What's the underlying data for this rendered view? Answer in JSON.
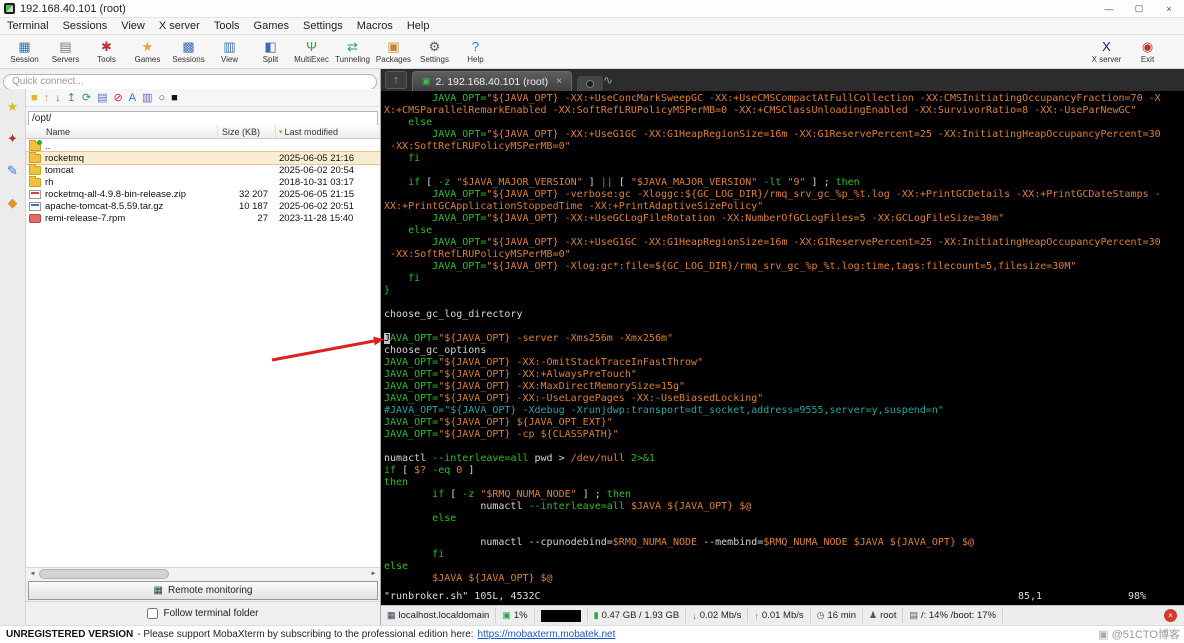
{
  "window": {
    "title": "192.168.40.101 (root)",
    "controls": {
      "minimize": "—",
      "maximize": "▢",
      "close": "×"
    }
  },
  "menu": {
    "items": [
      "Terminal",
      "Sessions",
      "View",
      "X server",
      "Tools",
      "Games",
      "Settings",
      "Macros",
      "Help"
    ]
  },
  "toolbar": {
    "left": [
      {
        "label": "Session",
        "glyph": "▦",
        "color": "#3b6fae"
      },
      {
        "label": "Servers",
        "glyph": "▤",
        "color": "#6f7d8c"
      },
      {
        "label": "Tools",
        "glyph": "✱",
        "color": "#c03030"
      },
      {
        "label": "Games",
        "glyph": "★",
        "color": "#e2a63d"
      },
      {
        "label": "Sessions",
        "glyph": "▩",
        "color": "#3b6fae"
      },
      {
        "label": "View",
        "glyph": "▥",
        "color": "#3b6fae"
      },
      {
        "label": "Split",
        "glyph": "◧",
        "color": "#3b6fae"
      },
      {
        "label": "MultiExec",
        "glyph": "Ψ",
        "color": "#2e9e50"
      },
      {
        "label": "Tunneling",
        "glyph": "⇄",
        "color": "#2e9e50"
      },
      {
        "label": "Packages",
        "glyph": "▣",
        "color": "#c8872f"
      },
      {
        "label": "Settings",
        "glyph": "⚙",
        "color": "#5a5a5a"
      },
      {
        "label": "Help",
        "glyph": "?",
        "color": "#2a7ade"
      }
    ],
    "right": [
      {
        "label": "X server",
        "glyph": "X",
        "color": "#15157d"
      },
      {
        "label": "Exit",
        "glyph": "◉",
        "color": "#c03030"
      }
    ]
  },
  "quick_connect": {
    "placeholder": "Quick connect..."
  },
  "side_tabs": [
    {
      "name": "sessions",
      "glyph": "★",
      "color": "#e2b52e"
    },
    {
      "name": "tools",
      "glyph": "✦",
      "color": "#b23030"
    },
    {
      "name": "macros",
      "glyph": "✎",
      "color": "#2a7ade"
    },
    {
      "name": "sftp",
      "glyph": "◆",
      "color": "#e2932e"
    }
  ],
  "file_browser": {
    "toolbar_icons": [
      {
        "name": "home-folder-icon",
        "glyph": "■",
        "color": "#e2b52e"
      },
      {
        "name": "up-folder-icon",
        "glyph": "↑",
        "color": "#caa22e"
      },
      {
        "name": "download-icon",
        "glyph": "↓",
        "color": "#4a7ab5"
      },
      {
        "name": "upload-icon",
        "glyph": "↥",
        "color": "#2e9e50"
      },
      {
        "name": "refresh-icon",
        "glyph": "⟳",
        "color": "#2e9e50"
      },
      {
        "name": "new-file-icon",
        "glyph": "▤",
        "color": "#4a7ab5"
      },
      {
        "name": "stop-icon",
        "glyph": "⊘",
        "color": "#c03030"
      },
      {
        "name": "encoding-icon",
        "glyph": "A",
        "color": "#2a7ade"
      },
      {
        "name": "chart-icon",
        "glyph": "▥",
        "color": "#7a4fc0"
      },
      {
        "name": "find-icon",
        "glyph": "○",
        "color": "#555555"
      },
      {
        "name": "terminal-icon",
        "glyph": "■",
        "color": "#111111"
      }
    ],
    "path": "/opt/",
    "columns": [
      "Name",
      "Size (KB)",
      "Last modified"
    ],
    "sort_indicator": "▾",
    "rows": [
      {
        "name": "..",
        "type": "folder-up",
        "size": "",
        "modified": "",
        "selected": false
      },
      {
        "name": "rocketmq",
        "type": "folder",
        "size": "",
        "modified": "2025-06-05 21:16",
        "selected": true
      },
      {
        "name": "tomcat",
        "type": "folder",
        "size": "",
        "modified": "2025-06-02 20:54",
        "selected": false
      },
      {
        "name": "rh",
        "type": "folder",
        "size": "",
        "modified": "2018-10-31 03:17",
        "selected": false
      },
      {
        "name": "rocketmq-all-4.9.8-bin-release.zip",
        "type": "zip",
        "size": "32 207",
        "modified": "2025-06-05 21:15",
        "selected": false
      },
      {
        "name": "apache-tomcat-8.5.59.tar.gz",
        "type": "targz",
        "size": "10 187",
        "modified": "2025-06-02 20:51",
        "selected": false
      },
      {
        "name": "remi-release-7.rpm",
        "type": "rpm",
        "size": "27",
        "modified": "2023-11-28 15:40",
        "selected": false
      }
    ],
    "scroll": {
      "left": "◄",
      "right": "►"
    },
    "remote_monitoring": {
      "icon": "▦",
      "label": "Remote monitoring"
    },
    "follow_terminal_label": "Follow terminal folder"
  },
  "terminal": {
    "nav_up_glyph": "↑",
    "tab": {
      "icon": "▣",
      "label": "2. 192.168.40.101 (root)",
      "close": "×"
    },
    "attach_glyph": "∿",
    "status": {
      "left": "\"runbroker.sh\" 105L, 4532C",
      "position": "85,1",
      "percent": "98%"
    },
    "lines": [
      [
        [
          "tw",
          "        "
        ],
        [
          "tg",
          "JAVA_OPT="
        ],
        [
          "to",
          "\"${JAVA_OPT} -XX:+UseConcMarkSweepGC -XX:+UseCMSCompactAtFullCollection -XX:CMSInitiatingOccupancyFraction=70 -X"
        ]
      ],
      [
        [
          "to",
          "X:+CMSParallelRemarkEnabled -XX:SoftRefLRUPolicyMSPerMB=0 -XX:+CMSClassUnloadingEnabled -XX:SurvivorRatio=8 -XX:-UseParNewGC\""
        ]
      ],
      [
        [
          "tw",
          "    "
        ],
        [
          "tg",
          "else"
        ]
      ],
      [
        [
          "tw",
          "        "
        ],
        [
          "tg",
          "JAVA_OPT="
        ],
        [
          "to",
          "\"${JAVA_OPT} -XX:+UseG1GC -XX:G1HeapRegionSize=16m -XX:G1ReservePercent=25 -XX:InitiatingHeapOccupancyPercent=30"
        ]
      ],
      [
        [
          "to",
          " -XX:SoftRefLRUPolicyMSPerMB=0\""
        ]
      ],
      [
        [
          "tw",
          "    "
        ],
        [
          "tg",
          "fi"
        ]
      ],
      [],
      [
        [
          "tw",
          "    "
        ],
        [
          "tg",
          "if"
        ],
        [
          "tw",
          " [ "
        ],
        [
          "tg",
          "-z"
        ],
        [
          "tw",
          " "
        ],
        [
          "to",
          "\"$JAVA_MAJOR_VERSION\""
        ],
        [
          "tw",
          " ] "
        ],
        [
          "tg",
          "||"
        ],
        [
          "tw",
          " [ "
        ],
        [
          "to",
          "\"$JAVA_MAJOR_VERSION\""
        ],
        [
          "tw",
          " "
        ],
        [
          "tg",
          "-lt"
        ],
        [
          "tw",
          " "
        ],
        [
          "to",
          "\"9\""
        ],
        [
          "tw",
          " ] ; "
        ],
        [
          "tg",
          "then"
        ]
      ],
      [
        [
          "tw",
          "        "
        ],
        [
          "tg",
          "JAVA_OPT="
        ],
        [
          "to",
          "\"${JAVA_OPT} -verbose:gc -Xloggc:${GC_LOG_DIR}/rmq_srv_gc_%p_%t.log -XX:+PrintGCDetails -XX:+PrintGCDateStamps -"
        ]
      ],
      [
        [
          "to",
          "XX:+PrintGCApplicationStoppedTime -XX:+PrintAdaptiveSizePolicy\""
        ]
      ],
      [
        [
          "tw",
          "        "
        ],
        [
          "tg",
          "JAVA_OPT="
        ],
        [
          "to",
          "\"${JAVA_OPT} -XX:+UseGCLogFileRotation -XX:NumberOfGCLogFiles=5 -XX:GCLogFileSize=30m\""
        ]
      ],
      [
        [
          "tw",
          "    "
        ],
        [
          "tg",
          "else"
        ]
      ],
      [
        [
          "tw",
          "        "
        ],
        [
          "tg",
          "JAVA_OPT="
        ],
        [
          "to",
          "\"${JAVA_OPT} -XX:+UseG1GC -XX:G1HeapRegionSize=16m -XX:G1ReservePercent=25 -XX:InitiatingHeapOccupancyPercent=30"
        ]
      ],
      [
        [
          "to",
          " -XX:SoftRefLRUPolicyMSPerMB=0\""
        ]
      ],
      [
        [
          "tw",
          "        "
        ],
        [
          "tg",
          "JAVA_OPT="
        ],
        [
          "to",
          "\"${JAVA_OPT} -Xlog:gc*:file=${GC_LOG_DIR}/rmq_srv_gc_%p_%t.log:time,tags:filecount=5,filesize=30M\""
        ]
      ],
      [
        [
          "tw",
          "    "
        ],
        [
          "tg",
          "fi"
        ]
      ],
      [
        [
          "tg",
          "}"
        ]
      ],
      [],
      [
        [
          "tw",
          "choose_gc_log_directory"
        ]
      ],
      [],
      [
        [
          "tk",
          "J"
        ],
        [
          "tg",
          "AVA_OPT="
        ],
        [
          "to",
          "\"${JAVA_OPT} -server -Xms256m -Xmx256m\""
        ]
      ],
      [
        [
          "tw",
          "choose_gc_options"
        ]
      ],
      [
        [
          "tg",
          "JAVA_OPT="
        ],
        [
          "to",
          "\"${JAVA_OPT} -XX:-OmitStackTraceInFastThrow\""
        ]
      ],
      [
        [
          "tg",
          "JAVA_OPT="
        ],
        [
          "to",
          "\"${JAVA_OPT} -XX:+AlwaysPreTouch\""
        ]
      ],
      [
        [
          "tg",
          "JAVA_OPT="
        ],
        [
          "to",
          "\"${JAVA_OPT} -XX:MaxDirectMemorySize=15g\""
        ]
      ],
      [
        [
          "tg",
          "JAVA_OPT="
        ],
        [
          "to",
          "\"${JAVA_OPT} -XX:-UseLargePages -XX:-UseBiasedLocking\""
        ]
      ],
      [
        [
          "tc",
          "#JAVA_OPT=\"${JAVA_OPT} -Xdebug -Xrunjdwp:transport=dt_socket,address=9555,server=y,suspend=n\""
        ]
      ],
      [
        [
          "tg",
          "JAVA_OPT="
        ],
        [
          "to",
          "\"${JAVA_OPT} ${JAVA_OPT_EXT}\""
        ]
      ],
      [
        [
          "tg",
          "JAVA_OPT="
        ],
        [
          "to",
          "\"${JAVA_OPT} -cp ${CLASSPATH}\""
        ]
      ],
      [],
      [
        [
          "tw",
          "numactl "
        ],
        [
          "tg",
          "--interleave=all"
        ],
        [
          "tw",
          " pwd > "
        ],
        [
          "to",
          "/dev/null"
        ],
        [
          "tw",
          " "
        ],
        [
          "tg",
          "2>&1"
        ]
      ],
      [
        [
          "tg",
          "if"
        ],
        [
          "tw",
          " [ "
        ],
        [
          "to",
          "$?"
        ],
        [
          "tw",
          " "
        ],
        [
          "tg",
          "-eq"
        ],
        [
          "tw",
          " "
        ],
        [
          "to",
          "0"
        ],
        [
          "tw",
          " ]"
        ]
      ],
      [
        [
          "tg",
          "then"
        ]
      ],
      [
        [
          "tw",
          "        "
        ],
        [
          "tg",
          "if"
        ],
        [
          "tw",
          " [ "
        ],
        [
          "tg",
          "-z"
        ],
        [
          "tw",
          " "
        ],
        [
          "to",
          "\"$RMQ_NUMA_NODE\""
        ],
        [
          "tw",
          " ] ; "
        ],
        [
          "tg",
          "then"
        ]
      ],
      [
        [
          "tw",
          "                numactl "
        ],
        [
          "tg",
          "--interleave=all"
        ],
        [
          "tw",
          " "
        ],
        [
          "to",
          "$JAVA ${JAVA_OPT} $@"
        ]
      ],
      [
        [
          "tw",
          "        "
        ],
        [
          "tg",
          "else"
        ]
      ],
      [],
      [
        [
          "tw",
          "                numactl --cpunodebind="
        ],
        [
          "to",
          "$RMQ_NUMA_NODE"
        ],
        [
          "tw",
          " --membind="
        ],
        [
          "to",
          "$RMQ_NUMA_NODE $JAVA ${JAVA_OPT} $@"
        ]
      ],
      [
        [
          "tw",
          "        "
        ],
        [
          "tg",
          "fi"
        ]
      ],
      [
        [
          "tg",
          "else"
        ]
      ],
      [
        [
          "tw",
          "        "
        ],
        [
          "to",
          "$JAVA ${JAVA_OPT} $@"
        ]
      ]
    ]
  },
  "status_bar": {
    "segments": [
      {
        "icon": "▦",
        "color": "#334455",
        "name": "host-icon",
        "text": "localhost.localdomain"
      },
      {
        "icon": "▣",
        "color": "#2e9e50",
        "name": "cpu-icon",
        "text": "1%"
      },
      {
        "graph": true,
        "name": "cpu-graph",
        "text": ""
      },
      {
        "icon": "▮",
        "color": "#2e9e50",
        "name": "memory-icon",
        "text": "0.47 GB / 1.93 GB"
      },
      {
        "icon": "↓",
        "color": "#2a7ade",
        "name": "download-speed-icon",
        "text": "0.02 Mb/s"
      },
      {
        "icon": "↑",
        "color": "#2e9e50",
        "name": "upload-speed-icon",
        "text": "0.01 Mb/s"
      },
      {
        "icon": "◷",
        "color": "#555555",
        "name": "uptime-icon",
        "text": "16 min"
      },
      {
        "icon": "♟",
        "color": "#555555",
        "name": "user-icon",
        "text": "root"
      },
      {
        "icon": "▤",
        "color": "#555555",
        "name": "disk-icon",
        "text": "/: 14%  /boot: 17%"
      }
    ],
    "close_glyph": "×"
  },
  "footer": {
    "bold": "UNREGISTERED VERSION",
    "text": "-  Please support MobaXterm by subscribing to the professional edition here:",
    "link": "https://mobaxterm.mobatek.net"
  },
  "annotation": {
    "arrow_color": "#e02020"
  },
  "watermark": {
    "icon": "▣",
    "text": "@51CTO博客"
  }
}
